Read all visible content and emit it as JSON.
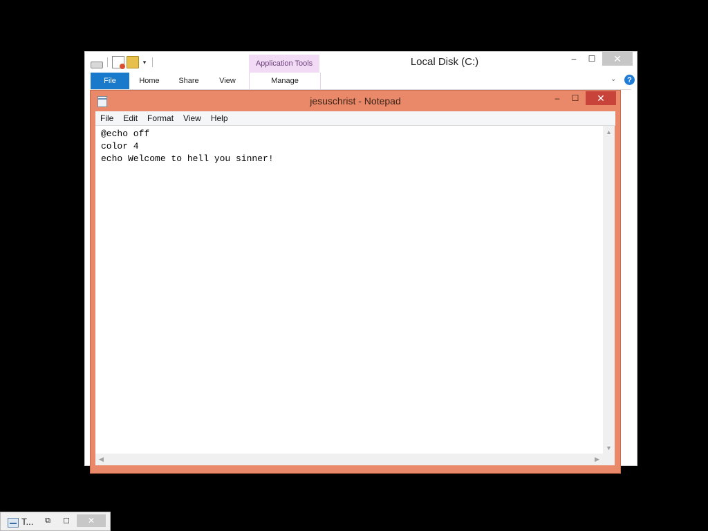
{
  "explorer": {
    "title": "Local Disk (C:)",
    "contextual_tab_group": "Application Tools",
    "tabs": [
      "File",
      "Home",
      "Share",
      "View",
      "Manage"
    ],
    "controls": {
      "minimize": "–",
      "maximize": "☐",
      "close": "✕"
    },
    "help": "?",
    "ribbon_chevron": "⌄",
    "qat_dropdown": "▾"
  },
  "notepad": {
    "title": "jesuschrist - Notepad",
    "menu": [
      "File",
      "Edit",
      "Format",
      "View",
      "Help"
    ],
    "content_lines": [
      "@echo off",
      "color 4",
      "echo Welcome to hell you sinner!"
    ],
    "controls": {
      "minimize": "–",
      "maximize": "☐",
      "close": "✕"
    },
    "scroll_arrows": {
      "up": "▲",
      "down": "▼",
      "left": "◀",
      "right": "▶"
    }
  },
  "minimized_window": {
    "label": "T...",
    "controls": {
      "restore": "⧉",
      "maximize": "☐",
      "close": "✕"
    }
  },
  "colors": {
    "desktop": "#000000",
    "notepad_frame": "#e9896a",
    "close_active": "#c8443b",
    "file_tab": "#1979ca",
    "contextual_tab": "#f2dcf5"
  }
}
